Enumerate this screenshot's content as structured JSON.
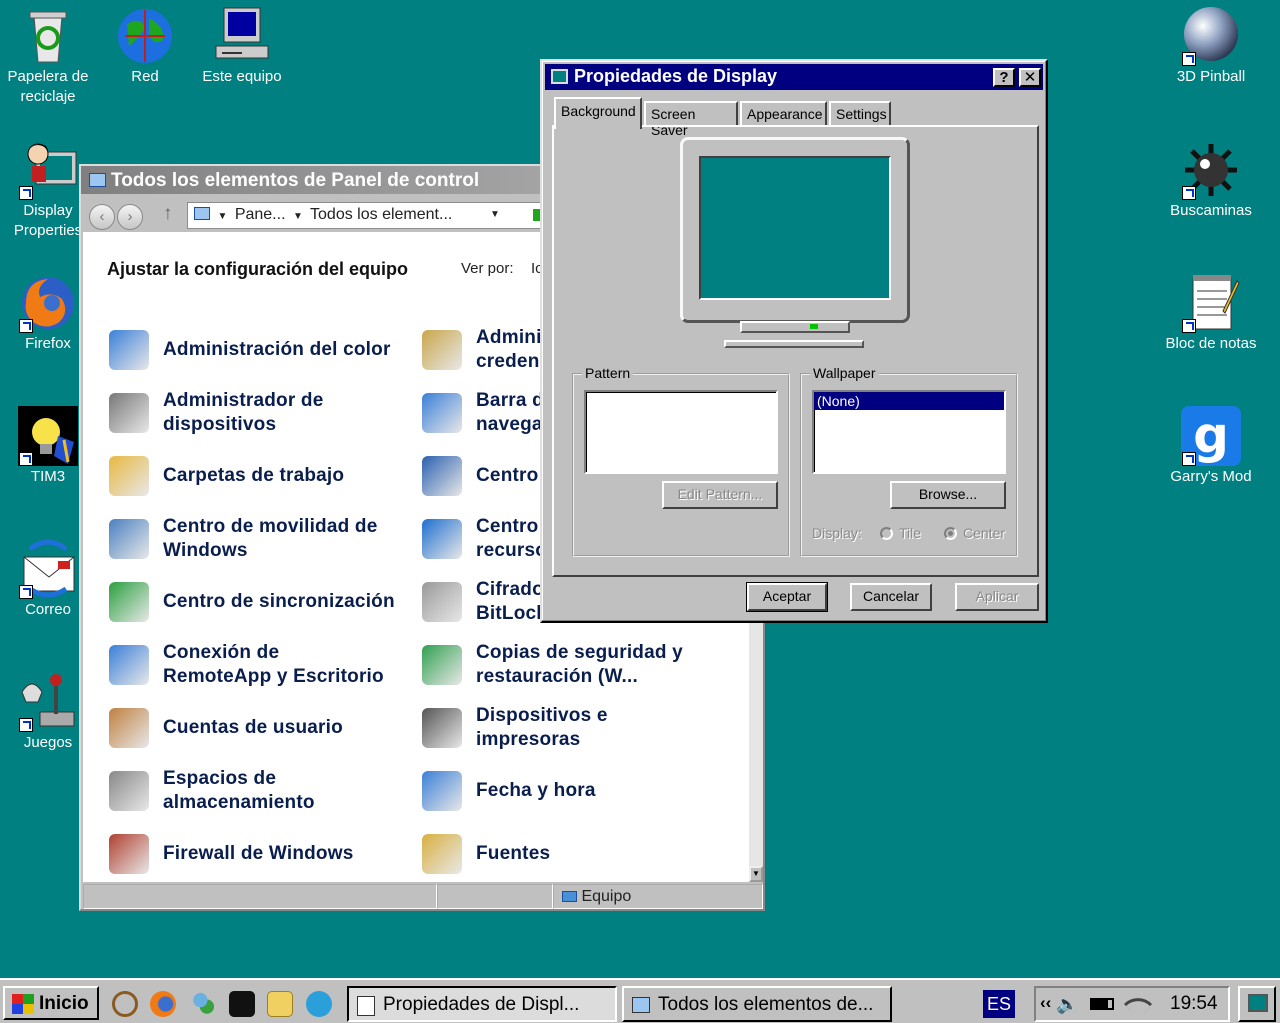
{
  "colors": {
    "desktop": "#008080",
    "titlebar_active": "#000080",
    "titlebar_inactive": "#808080",
    "link_text": "#0a1e4d"
  },
  "desktop_icons": {
    "recycle": "Papelera de reciclaje",
    "network": "Red",
    "computer": "Este equipo",
    "display": "Display Properties",
    "firefox": "Firefox",
    "tim3": "TIM3",
    "mail": "Correo",
    "games": "Juegos",
    "pinball": "3D Pinball",
    "minesweeper": "Buscaminas",
    "notepad": "Bloc de notas",
    "gmod": "Garry's Mod"
  },
  "control_panel": {
    "title": "Todos los elementos de Panel de control",
    "breadcrumb_1": "Pane...",
    "breadcrumb_2": "Todos los element...",
    "heading": "Ajustar la configuración del equipo",
    "view_by_label": "Ver por:",
    "view_by_value": "Ic",
    "status_location": "Equipo",
    "items": [
      {
        "label": "Administración del color",
        "icon": "color-management-icon"
      },
      {
        "label": "Admini\ncreden",
        "icon": "credential-manager-icon"
      },
      {
        "label": "Administrador de\ndispositivos",
        "icon": "device-manager-icon"
      },
      {
        "label": "Barra d\nnavega",
        "icon": "navigation-bar-icon"
      },
      {
        "label": "Carpetas de trabajo",
        "icon": "work-folders-icon"
      },
      {
        "label": "Centro",
        "icon": "ease-of-access-icon"
      },
      {
        "label": "Centro de movilidad de\nWindows",
        "icon": "mobility-center-icon"
      },
      {
        "label": "Centro\nrecurso",
        "icon": "resources-center-icon"
      },
      {
        "label": "Centro de sincronización",
        "icon": "sync-center-icon"
      },
      {
        "label": "Cifrado\nBitLocker",
        "icon": "bitlocker-icon"
      },
      {
        "label": "Conexión de\nRemoteApp y Escritorio",
        "icon": "remoteapp-icon"
      },
      {
        "label": "Copias de seguridad y\nrestauración (W...",
        "icon": "backup-icon"
      },
      {
        "label": "Cuentas de usuario",
        "icon": "user-accounts-icon"
      },
      {
        "label": "Dispositivos e\nimpresoras",
        "icon": "devices-printers-icon"
      },
      {
        "label": "Espacios de\nalmacenamiento",
        "icon": "storage-spaces-icon"
      },
      {
        "label": "Fecha y hora",
        "icon": "date-time-icon"
      },
      {
        "label": "Firewall de Windows",
        "icon": "firewall-icon"
      },
      {
        "label": "Fuentes",
        "icon": "fonts-icon"
      }
    ]
  },
  "display_dialog": {
    "title": "Propiedades de Display",
    "help_btn": "?",
    "close_btn": "✕",
    "tabs": [
      "Background",
      "Screen Saver",
      "Appearance",
      "Settings"
    ],
    "pattern_label": "Pattern",
    "edit_pattern": "Edit Pattern...",
    "wallpaper_label": "Wallpaper",
    "wallpaper_selected": "(None)",
    "browse": "Browse...",
    "display_label": "Display:",
    "tile": "Tile",
    "center": "Center",
    "ok": "Aceptar",
    "cancel": "Cancelar",
    "apply": "Aplicar"
  },
  "taskbar": {
    "start": "Inicio",
    "task_display": "Propiedades de Displ...",
    "task_cp": "Todos los elementos de...",
    "lang": "ES",
    "clock": "19:54",
    "chevron": "‹‹"
  }
}
